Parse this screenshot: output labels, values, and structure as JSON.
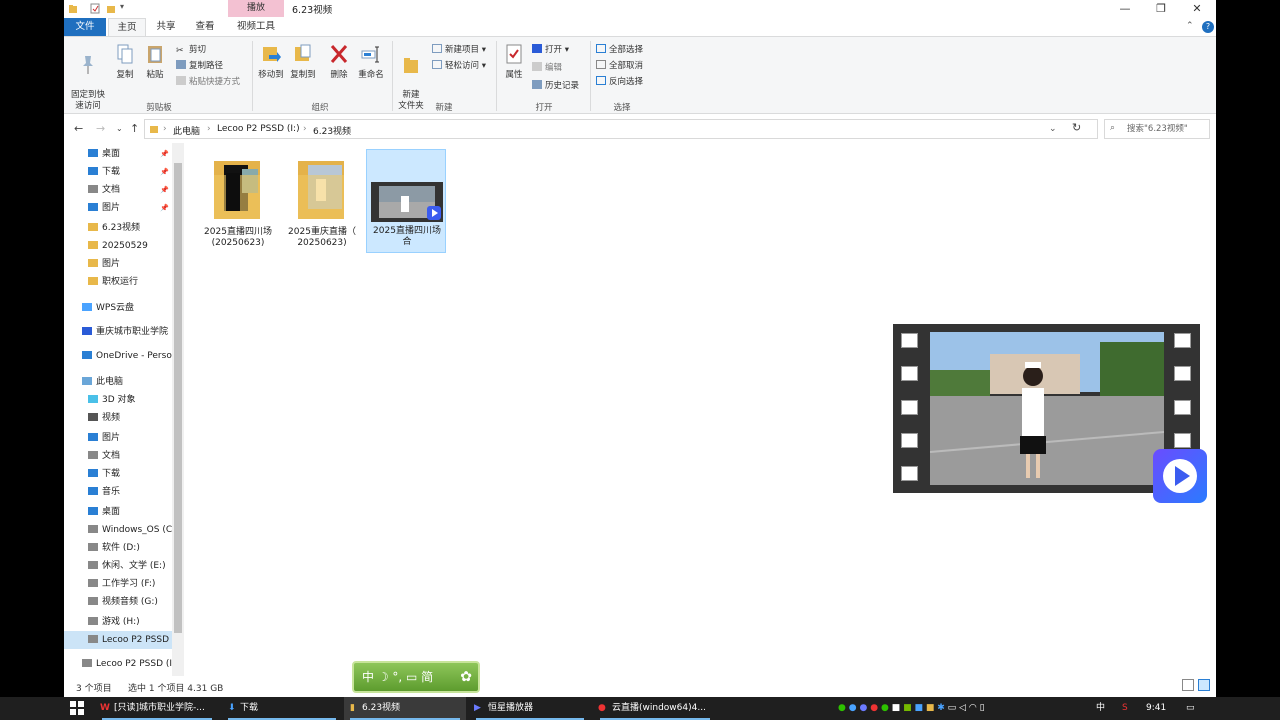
{
  "window": {
    "title": "6.23视频",
    "context_tab": "播放",
    "controls": [
      "—",
      "❐",
      "✕"
    ]
  },
  "tabs": [
    {
      "label": "文件"
    },
    {
      "label": "主页"
    },
    {
      "label": "共享"
    },
    {
      "label": "查看"
    },
    {
      "label": "视频工具"
    }
  ],
  "ribbon": {
    "pin_label": "固定到快\n速访问",
    "copy_label": "复制",
    "paste_label": "粘贴",
    "cut_label": "剪切",
    "copy_path_label": "复制路径",
    "paste_shortcut_label": "粘贴快捷方式",
    "clipboard_group": "剪贴板",
    "move_to_label": "移动到",
    "copy_to_label": "复制到",
    "delete_label": "删除",
    "rename_label": "重命名",
    "organize_group": "组织",
    "new_folder_label": "新建\n文件夹",
    "new_item_label": "新建项目",
    "easy_access_label": "轻松访问",
    "new_group": "新建",
    "properties_label": "属性",
    "open_label": "打开",
    "edit_label": "编辑",
    "history_label": "历史记录",
    "open_group": "打开",
    "select_all_label": "全部选择",
    "select_none_label": "全部取消",
    "invert_label": "反向选择",
    "select_group": "选择"
  },
  "address": {
    "crumbs": [
      "此电脑",
      "Lecoo P2 PSSD (I:)",
      "6.23视频"
    ],
    "search_placeholder": "搜索\"6.23视频\""
  },
  "nav": {
    "items": [
      {
        "label": "桌面",
        "pinned": true
      },
      {
        "label": "下载",
        "pinned": true
      },
      {
        "label": "文档",
        "pinned": true
      },
      {
        "label": "图片",
        "pinned": true
      },
      {
        "label": "6.23视频"
      },
      {
        "label": "20250529"
      },
      {
        "label": "图片"
      },
      {
        "label": "职权运行"
      },
      {
        "label": "WPS云盘"
      },
      {
        "label": "重庆城市职业学院"
      },
      {
        "label": "OneDrive - Perso"
      },
      {
        "label": "此电脑"
      },
      {
        "label": "3D 对象"
      },
      {
        "label": "视频"
      },
      {
        "label": "图片"
      },
      {
        "label": "文档"
      },
      {
        "label": "下载"
      },
      {
        "label": "音乐"
      },
      {
        "label": "桌面"
      },
      {
        "label": "Windows_OS (C"
      },
      {
        "label": "软件 (D:)"
      },
      {
        "label": "休闲、文学 (E:)"
      },
      {
        "label": "工作学习 (F:)"
      },
      {
        "label": "视频音频 (G:)"
      },
      {
        "label": "游戏 (H:)"
      },
      {
        "label": "Lecoo P2 PSSD",
        "selected": true
      },
      {
        "label": "Lecoo P2 PSSD (I"
      }
    ]
  },
  "files": [
    {
      "name": "2025直播四川场\n(20250623)",
      "type": "folder"
    },
    {
      "name": "2025重庆直播（\n20250623)",
      "type": "folder"
    },
    {
      "name": "2025直播四川场\n合",
      "type": "video",
      "selected": true
    }
  ],
  "status": {
    "count": "3 个项目",
    "selection": "选中 1 个项目  4.31 GB"
  },
  "ime_label": "中 ☽ °, ▭ 简",
  "taskbar": {
    "items": [
      {
        "label": "[只读]城市职业学院-..."
      },
      {
        "label": "下载"
      },
      {
        "label": "6.23视频"
      },
      {
        "label": "恒星播放器"
      },
      {
        "label": "云直播(window64)4..."
      }
    ],
    "ime": "中",
    "time": "9:41"
  },
  "colors": {
    "accent": "#1f6fbf",
    "selection": "#cce8ff",
    "context_tab": "#f3c1d2",
    "taskbar": "#1f1f1f"
  }
}
